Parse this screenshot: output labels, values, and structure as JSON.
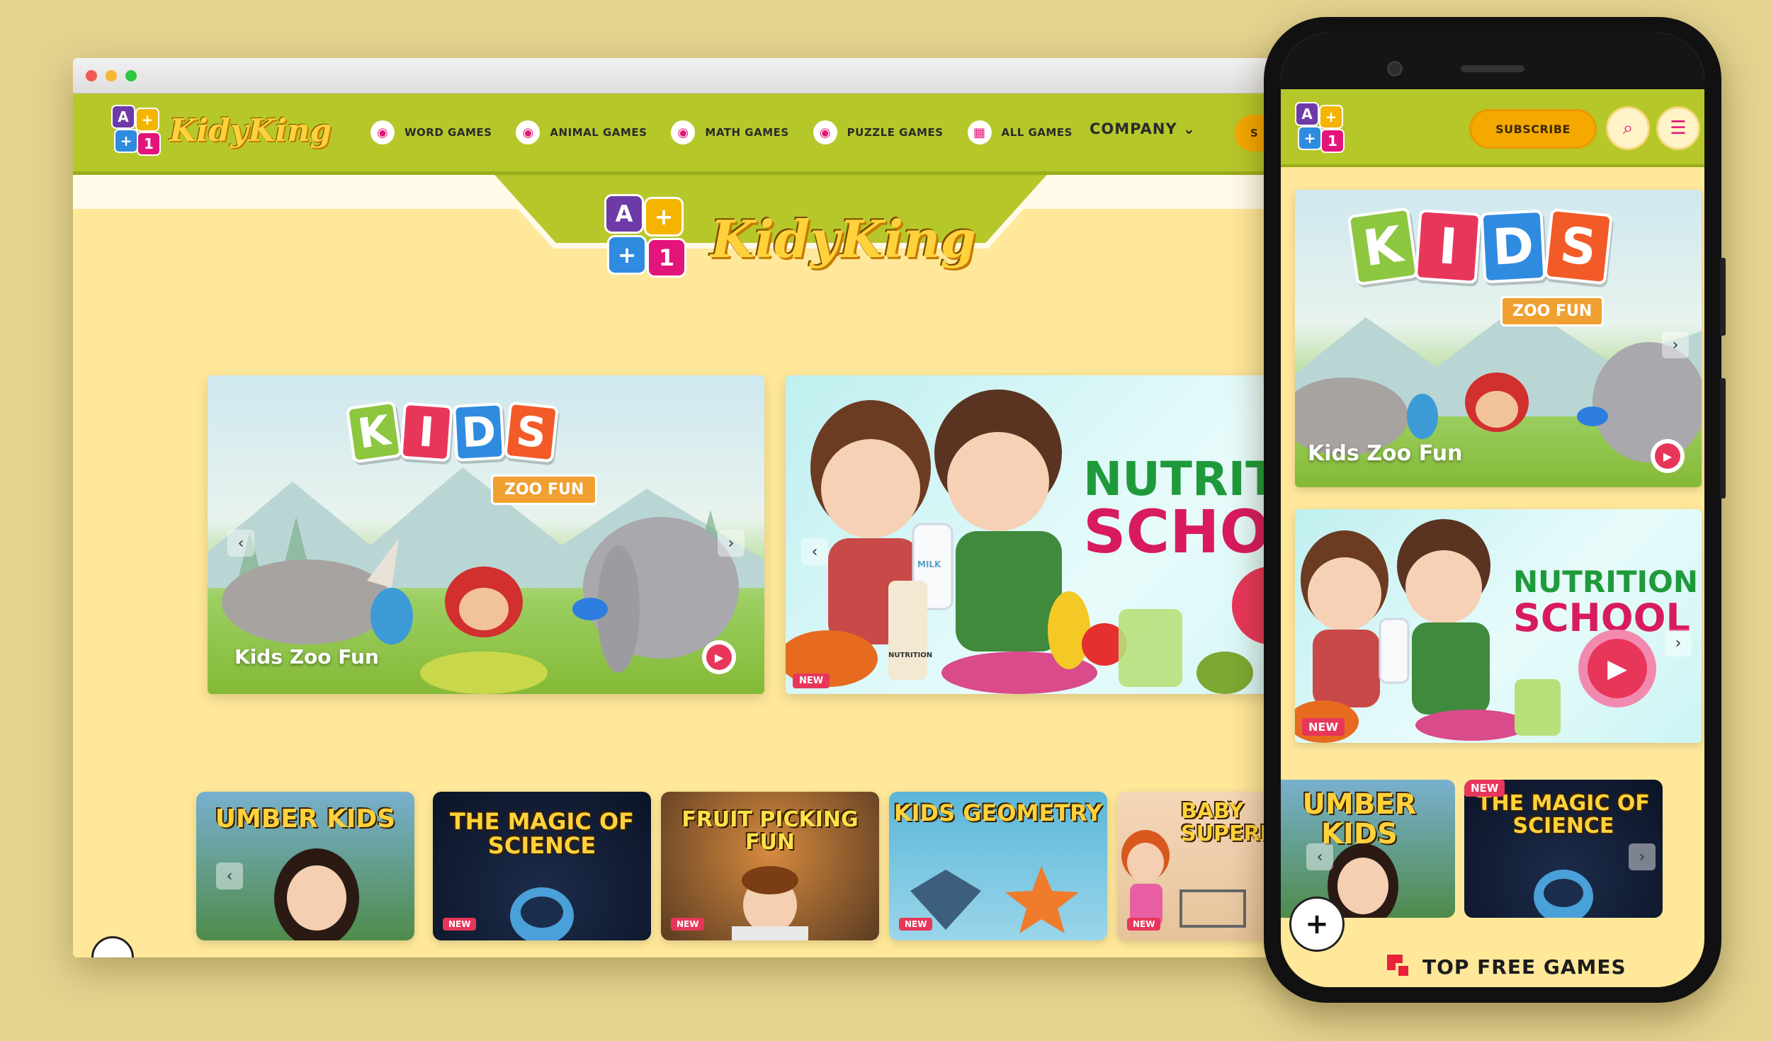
{
  "site": {
    "brand": "KidyKing",
    "logo_letters": [
      "A",
      "+",
      "+",
      "1"
    ]
  },
  "nav": {
    "items": [
      {
        "label": "WORD GAMES",
        "icon": "palette-icon"
      },
      {
        "label": "ANIMAL GAMES",
        "icon": "palette-icon"
      },
      {
        "label": "MATH GAMES",
        "icon": "palette-icon"
      },
      {
        "label": "PUZZLE GAMES",
        "icon": "palette-icon"
      },
      {
        "label": "ALL GAMES",
        "icon": "grid-icon"
      }
    ],
    "company": "COMPANY",
    "subscribe_partial": "S"
  },
  "hero": {
    "slides": [
      {
        "title": "Kids Zoo Fun",
        "art_word": [
          "K",
          "I",
          "D",
          "S"
        ],
        "art_tag": "ZOO FUN"
      },
      {
        "art_line1": "NUTRITI",
        "art_line2": "SCHO",
        "badge": "NEW",
        "milk_label": "MILK",
        "jar_label": "NUTRITION"
      }
    ]
  },
  "thumbnails": [
    {
      "title": "UMBER KIDS",
      "badge": ""
    },
    {
      "title": "THE MAGIC OF SCIENCE",
      "badge": "NEW"
    },
    {
      "title": "FRUIT PICKING FUN",
      "badge": "NEW"
    },
    {
      "title": "KIDS GEOMETRY",
      "badge": "NEW"
    },
    {
      "title": "BABY SUPERMARKET",
      "badge": "NEW"
    }
  ],
  "phone": {
    "subscribe": "SUBSCRIBE",
    "slides": [
      {
        "title": "Kids Zoo Fun",
        "art_tag": "ZOO FUN"
      },
      {
        "art_line1": "NUTRITION",
        "art_line2": "SCHOOL",
        "badge": "NEW"
      }
    ],
    "thumbnails": [
      {
        "title": "UMBER KIDS",
        "badge": ""
      },
      {
        "title": "THE MAGIC OF SCIENCE",
        "badge": "NEW"
      }
    ],
    "fab": "+",
    "section_title": "TOP FREE GAMES"
  },
  "colors": {
    "background": "#e3d38f",
    "header": "#b6c72a",
    "page": "#ffe89a",
    "accent": "#f5a800",
    "badge": "#e8365a"
  }
}
